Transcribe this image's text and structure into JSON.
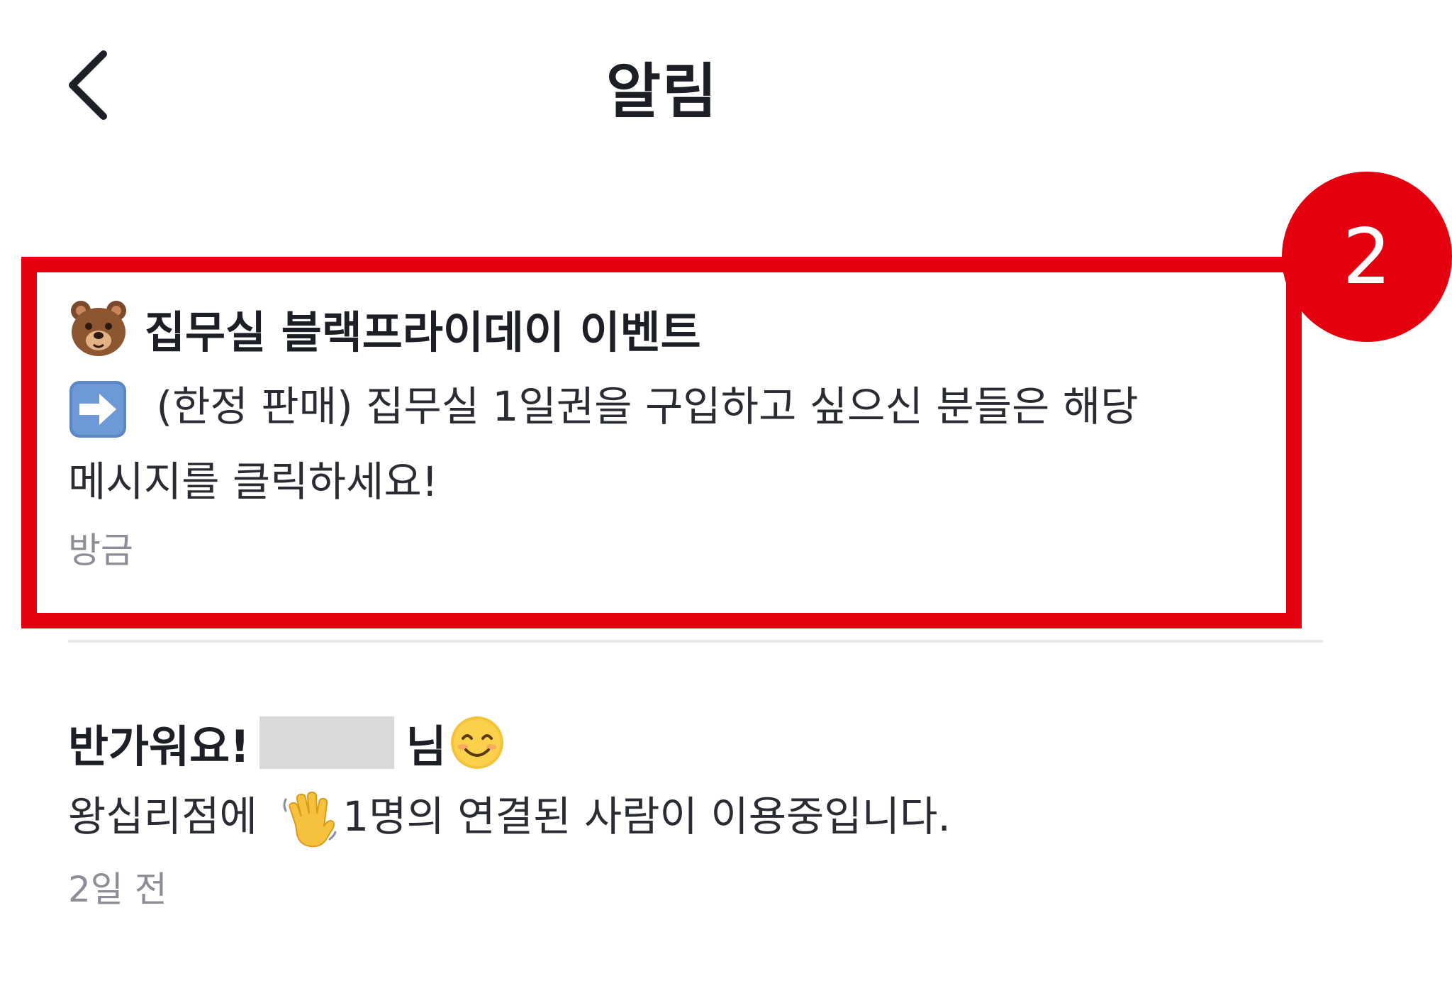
{
  "header": {
    "back_icon": "chevron-left-icon",
    "title": "알림"
  },
  "notifications": [
    {
      "icon": "bear-emoji-icon",
      "title": "집무실 블랙프라이데이 이벤트",
      "body_icon": "right-arrow-emoji-icon",
      "body_line1": "(한정 판매) 집무실 1일권을 구입하고 싶으신 분들은 해당",
      "body_line2": "메시지를 클릭하세요!",
      "time": "방금"
    },
    {
      "title_prefix": "반가워요!",
      "title_suffix": "님",
      "title_icon": "smiling-face-emoji-icon",
      "body_prefix": "왕십리점에",
      "body_icon": "waving-hand-emoji-icon",
      "body_suffix": "1명의 연결된 사람이 이용중입니다.",
      "time": "2일 전"
    }
  ],
  "annotation": {
    "badge_number": "2",
    "color": "#e4000f"
  }
}
